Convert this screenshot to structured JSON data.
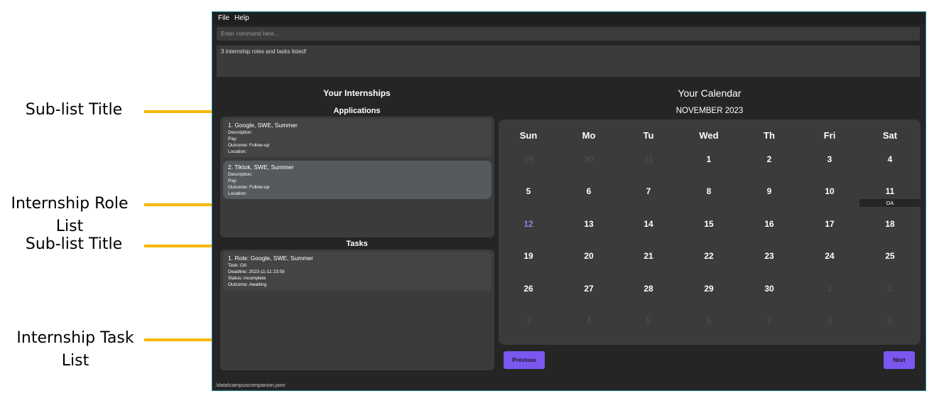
{
  "annotations": {
    "sublist_title_1": "Sub-list Title",
    "role_list_line1": "Internship Role",
    "role_list_line2": "List",
    "sublist_title_2": "Sub-list Title",
    "task_list_line1": "Internship Task",
    "task_list_line2": "List",
    "arrow_color": "#f5b800"
  },
  "menu": {
    "file": "File",
    "help": "Help"
  },
  "command": {
    "placeholder": "Enter command here..."
  },
  "result": {
    "text": "3 internship roles and tasks listed!"
  },
  "internships": {
    "title": "Your Internships",
    "applications_title": "Applications",
    "applications": [
      {
        "title": "1.  Google, SWE, Summer",
        "description": "Description:",
        "pay": "Pay:",
        "outcome": "Outcome: Follow-up",
        "location": "Location:"
      },
      {
        "title": "2.  Tiktok, SWE, Summer",
        "description": "Description:",
        "pay": "Pay:",
        "outcome": "Outcome: Follow-up",
        "location": "Location:"
      }
    ],
    "tasks_title": "Tasks",
    "tasks": [
      {
        "title": "1.  Role: Google, SWE, Summer",
        "task": "Task: OA",
        "deadline": "Deadline: 2023-11-11 23:59",
        "status": "Status: incomplete",
        "outcome": "Outcome: Awaiting"
      }
    ]
  },
  "calendar": {
    "title": "Your Calendar",
    "month": "NOVEMBER 2023",
    "days": [
      "Sun",
      "Mo",
      "Tu",
      "Wed",
      "Th",
      "Fri",
      "Sat"
    ],
    "weeks": [
      [
        "29",
        "30",
        "31",
        "1",
        "2",
        "3",
        "4"
      ],
      [
        "5",
        "6",
        "7",
        "8",
        "9",
        "10",
        "11"
      ],
      [
        "12",
        "13",
        "14",
        "15",
        "16",
        "17",
        "18"
      ],
      [
        "19",
        "20",
        "21",
        "22",
        "23",
        "24",
        "25"
      ],
      [
        "26",
        "27",
        "28",
        "29",
        "30",
        "1",
        "2"
      ],
      [
        "3",
        "4",
        "5",
        "6",
        "7",
        "8",
        "9"
      ]
    ],
    "dimmed": [
      "0-0",
      "0-1",
      "0-2",
      "4-5",
      "4-6",
      "5-0",
      "5-1",
      "5-2",
      "5-3",
      "5-4",
      "5-5",
      "5-6"
    ],
    "today": "2-0",
    "event": {
      "day": "11",
      "label": "OA"
    },
    "accent_color": "#7b57f0",
    "today_color": "#a875e8",
    "previous": "Previous",
    "next": "Next"
  },
  "status_bar": {
    "path": ".\\data\\campuscompanion.json"
  }
}
